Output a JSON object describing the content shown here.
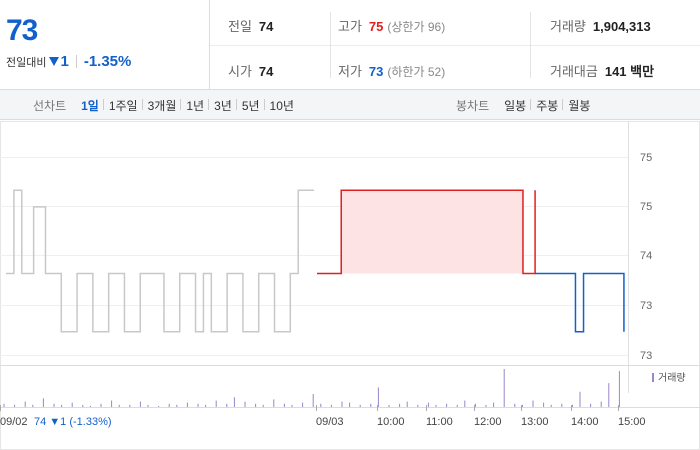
{
  "quote": {
    "price": "73",
    "change_label": "전일대비",
    "change_value": "1",
    "change_rate": "-1.35%",
    "prev_close": {
      "label": "전일",
      "value": "74"
    },
    "high": {
      "label": "고가",
      "value": "75",
      "sub": "(상한가 96)"
    },
    "volume": {
      "label": "거래량",
      "value": "1,904,313"
    },
    "open": {
      "label": "시가",
      "value": "74"
    },
    "low": {
      "label": "저가",
      "value": "73",
      "sub": "(하한가 52)"
    },
    "amount": {
      "label": "거래대금",
      "value": "141 백만"
    }
  },
  "toolbar": {
    "line_chart_label": "선차트",
    "line_periods": [
      "1일",
      "1주일",
      "3개월",
      "1년",
      "3년",
      "5년",
      "10년"
    ],
    "active_period": "1일",
    "candle_chart_label": "봉차트",
    "candle_periods": [
      "일봉",
      "주봉",
      "월봉"
    ]
  },
  "colors": {
    "up": "#e02020",
    "down": "#1260cc",
    "prev_day_line": "#c8c8c8",
    "volume_bar": "#9a86c8"
  },
  "chart_data": {
    "type": "line",
    "price_axis_labels": [
      "75",
      "75",
      "74",
      "73",
      "73"
    ],
    "ylim": [
      72.9,
      75.4
    ],
    "reference_price": 74,
    "volume_legend": "거래량",
    "x_tick_labels": [
      "09/02",
      "09/03",
      "10:00",
      "11:00",
      "12:00",
      "13:00",
      "14:00",
      "15:00"
    ],
    "prev_day_summary": {
      "date": "09/02",
      "price": "74",
      "change": "1",
      "rate": "(-1.33%)"
    },
    "series": [
      {
        "segment": "prev_day",
        "x": [
          "09/02 09:00",
          "09:10",
          "09:20",
          "09:35",
          "09:50",
          "10:10",
          "10:30",
          "10:50",
          "11:10",
          "11:30",
          "11:50",
          "12:20",
          "12:40",
          "13:00",
          "13:10",
          "13:20",
          "13:40",
          "14:00",
          "14:20",
          "14:40",
          "15:00",
          "15:10",
          "15:20",
          "15:30"
        ],
        "values": [
          74,
          75,
          74,
          74.8,
          74,
          73.3,
          74,
          73.3,
          74,
          73.3,
          74,
          73.3,
          74,
          73.3,
          74,
          73.3,
          74,
          73.3,
          74,
          73.3,
          74,
          75,
          75,
          75
        ]
      },
      {
        "segment": "today_up",
        "x": [
          "09/03 09:00",
          "09:30",
          "10:00",
          "10:30",
          "11:00",
          "11:30",
          "12:00",
          "12:30",
          "13:00",
          "13:15",
          "13:30"
        ],
        "values": [
          74,
          75,
          75,
          75,
          75,
          75,
          75,
          75,
          75,
          74,
          75
        ]
      },
      {
        "segment": "today_down",
        "x": [
          "13:30",
          "14:00",
          "14:10",
          "14:20",
          "14:30",
          "14:50",
          "15:00",
          "15:20"
        ],
        "values": [
          74,
          74,
          74,
          73.3,
          74,
          74,
          74,
          73.3
        ]
      }
    ],
    "volume_values": [
      3,
      2,
      5,
      2,
      8,
      3,
      2,
      4,
      2,
      1,
      3,
      6,
      2,
      2,
      5,
      2,
      1,
      3,
      2,
      4,
      3,
      2,
      6,
      3,
      9,
      5,
      3,
      2,
      7,
      3,
      2,
      4,
      12,
      3,
      2,
      5,
      4,
      2,
      3,
      18,
      2,
      3,
      5,
      2,
      4,
      2,
      3,
      2,
      6,
      3,
      2,
      4,
      35,
      3,
      2,
      6,
      4,
      2,
      3,
      2,
      14,
      3,
      5,
      22,
      33
    ]
  }
}
